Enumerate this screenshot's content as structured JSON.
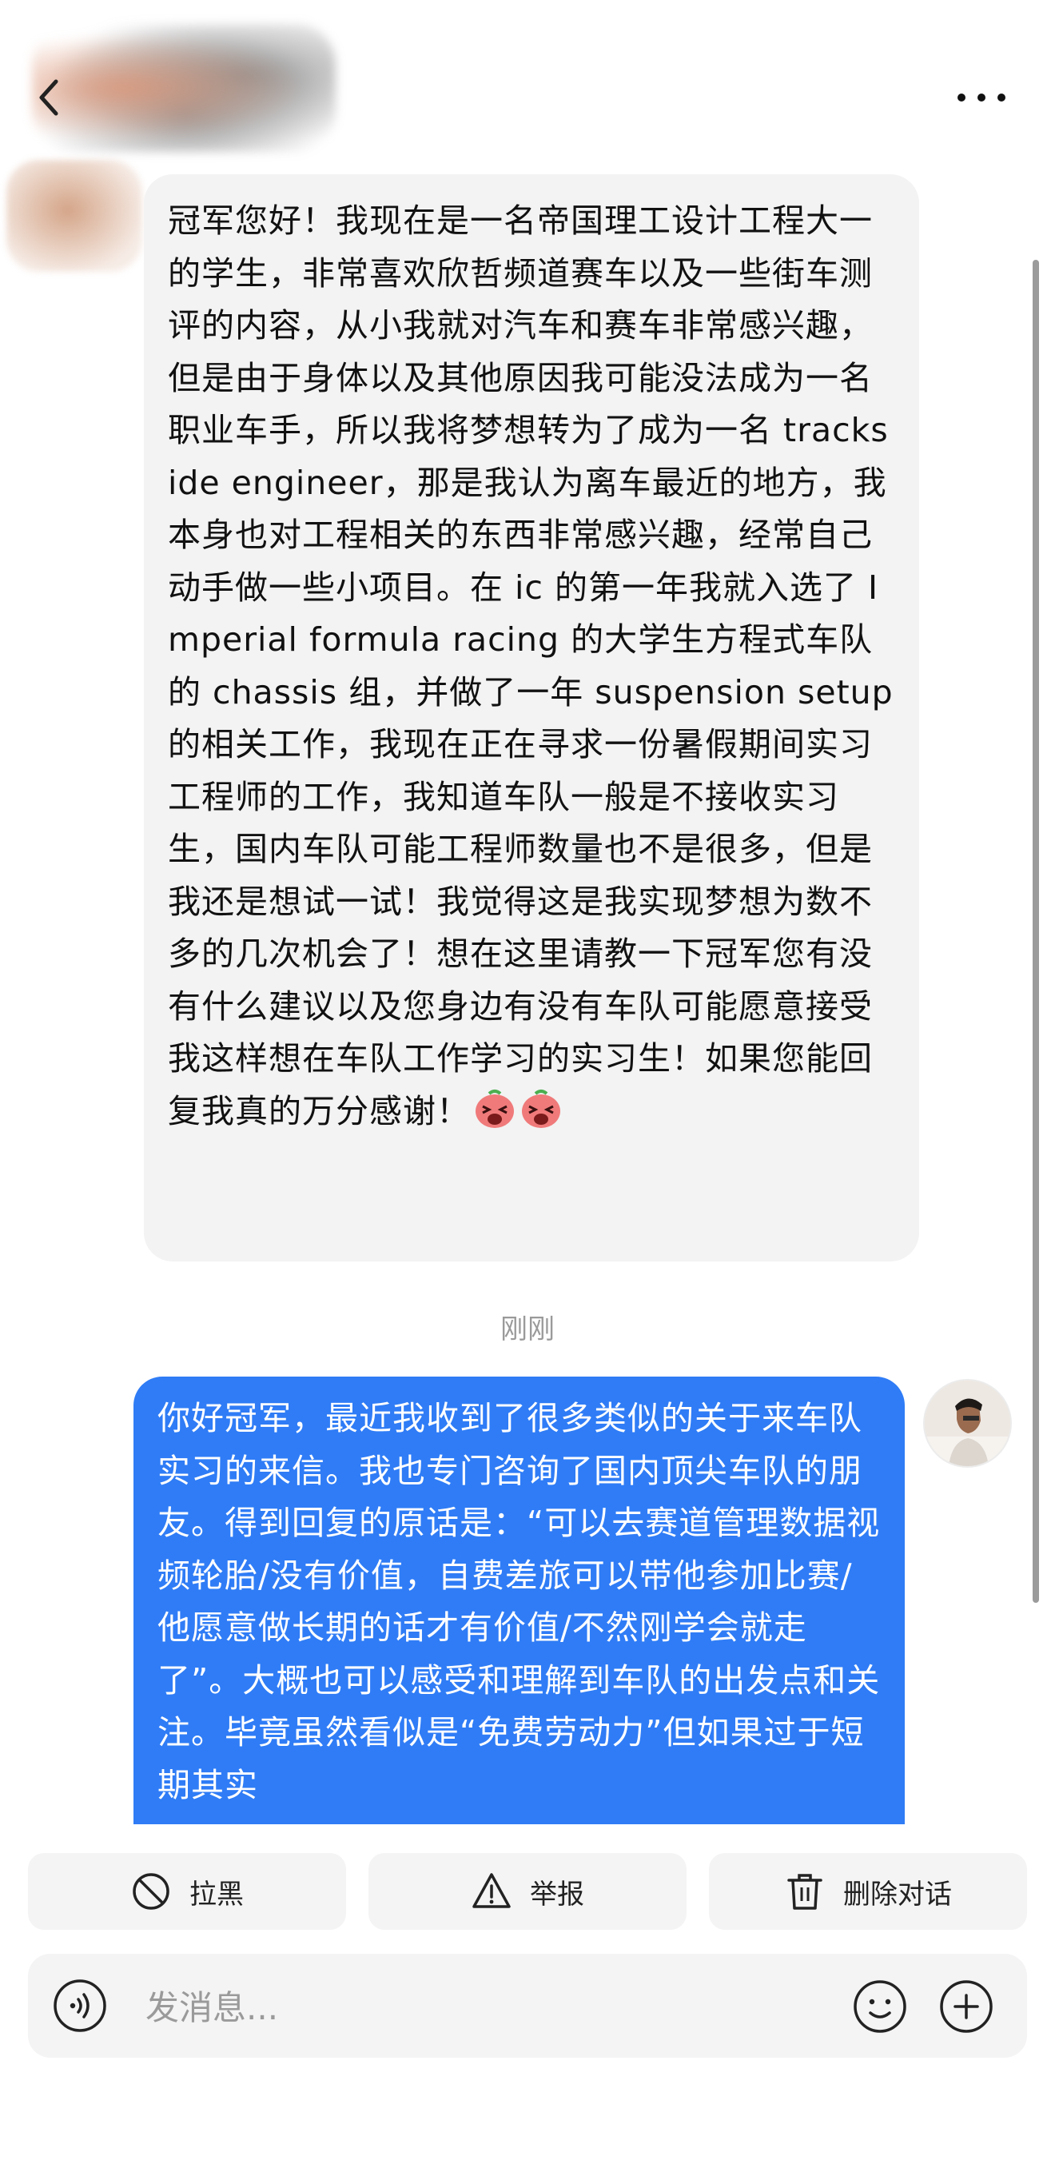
{
  "messages": {
    "incoming_text": "冠军您好！我现在是一名帝国理工设计工程大一的学生，非常喜欢欣哲频道赛车以及一些街车测评的内容，从小我就对汽车和赛车非常感兴趣，但是由于身体以及其他原因我可能没法成为一名职业车手，所以我将梦想转为了成为一名 trackside engineer，那是我认为离车最近的地方，我本身也对工程相关的东西非常感兴趣，经常自己动手做一些小项目。在 ic 的第一年我就入选了 Imperial formula racing 的大学生方程式车队的 chassis 组，并做了一年 suspension setup 的相关工作，我现在正在寻求一份暑假期间实习工程师的工作，我知道车队一般是不接收实习生，国内车队可能工程师数量也不是很多，但是我还是想试一试！我觉得这是我实现梦想为数不多的几次机会了！想在这里请教一下冠军您有没有什么建议以及您身边有没有车队可能愿意接受我这样想在车队工作学习的实习生！如果您能回复我真的万分感谢！",
    "timestamp": "刚刚",
    "outgoing_text": "你好冠军，最近我收到了很多类似的关于来车队实习的来信。我也专门咨询了国内顶尖车队的朋友。得到回复的原话是：“可以去赛道管理数据视频轮胎/没有价值，自费差旅可以带他参加比赛/他愿意做长期的话才有价值/不然刚学会就走了”。大概也可以感受和理解到车队的出发点和关注。毕竟虽然看似是“免费劳动力”但如果过于短期其实"
  },
  "actions": {
    "block_label": "拉黑",
    "report_label": "举报",
    "delete_label": "删除对话"
  },
  "composer": {
    "placeholder": "发消息..."
  },
  "colors": {
    "outgoing_bubble": "#2f7cf6",
    "incoming_bubble": "#f3f3f3"
  }
}
